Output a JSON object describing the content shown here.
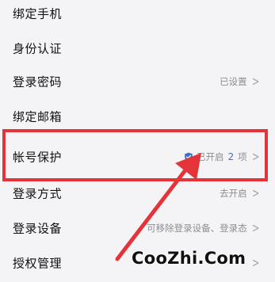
{
  "settings": {
    "items": [
      {
        "label": "绑定手机"
      },
      {
        "label": "身份认证"
      },
      {
        "label": "登录密码",
        "value": "已设置"
      },
      {
        "label": "绑定邮箱"
      },
      {
        "label": "帐号保护",
        "status_prefix": "已开启",
        "count": "2",
        "count_unit": "项",
        "icon": "shield-check-icon"
      },
      {
        "label": "登录方式",
        "value": "去开启"
      },
      {
        "label": "登录设备",
        "value": "可移除登录设备、登录态"
      },
      {
        "label": "授权管理"
      }
    ]
  },
  "annotation": {
    "highlight_color": "#e5333a"
  },
  "watermark": {
    "text": "CooZhi.Com"
  },
  "colors": {
    "background": "#f4f4f6",
    "accent": "#3b6fd8"
  }
}
